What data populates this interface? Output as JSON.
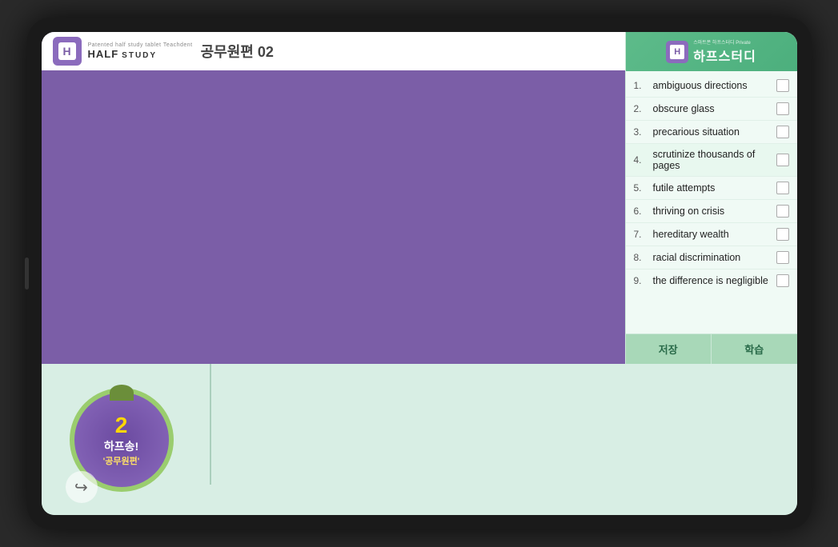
{
  "tablet": {
    "brand": {
      "logo_text": "H",
      "top_label": "Patented half study tablet Teachdent",
      "half": "HALF",
      "study": "STUDY"
    },
    "title": "공무원편 02",
    "sidebar": {
      "header": {
        "logo_text": "H",
        "brand_top": "스마트폰 하프스터디 Private",
        "title": "하프스터디"
      },
      "items": [
        {
          "number": "1.",
          "text": "ambiguous directions",
          "checked": false
        },
        {
          "number": "2.",
          "text": "obscure glass",
          "checked": false
        },
        {
          "number": "3.",
          "text": "precarious situation",
          "checked": false
        },
        {
          "number": "4.",
          "text": "scrutinize thousands of pages",
          "checked": false,
          "highlight": true
        },
        {
          "number": "5.",
          "text": "futile attempts",
          "checked": false
        },
        {
          "number": "6.",
          "text": "thriving on crisis",
          "checked": false
        },
        {
          "number": "7.",
          "text": "hereditary wealth",
          "checked": false
        },
        {
          "number": "8.",
          "text": "racial discrimination",
          "checked": false
        },
        {
          "number": "9.",
          "text": "the difference is negligible",
          "checked": false
        }
      ],
      "save_label": "저장",
      "study_label": "학습"
    },
    "bottom": {
      "song_number": "2",
      "song_label": "하프송!",
      "song_sub": "'공무원편'"
    }
  }
}
